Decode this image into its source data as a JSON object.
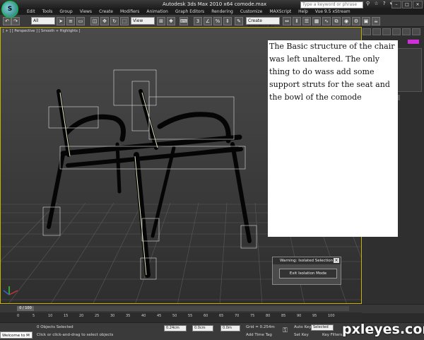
{
  "title": {
    "text": "Autodesk 3ds Max  2010 x64      comode.max",
    "search_placeholder": "Type a keyword or phrase"
  },
  "menu": [
    "Edit",
    "Tools",
    "Group",
    "Views",
    "Create",
    "Modifiers",
    "Animation",
    "Graph Editors",
    "Rendering",
    "Customize",
    "MAXScript",
    "Help",
    "Vue 9.5 xStream"
  ],
  "toolbar": {
    "selection_filter": "All",
    "reference_coord": "View",
    "named_selection": "Create Selection Se"
  },
  "viewport": {
    "label": "[ + ] [ Perspective ] [ Smooth + Highlights ]"
  },
  "note": {
    "text": "The Basic structure of the chair was left unaltered. The only thing to do wass add some support struts for the seat and the bowl of the comode"
  },
  "dialog": {
    "title": "Warning: Isolated Selection",
    "button": "Exit Isolation Mode"
  },
  "timeline": {
    "frame": "0 / 100",
    "ticks": [
      "0",
      "5",
      "10",
      "15",
      "20",
      "25",
      "30",
      "35",
      "40",
      "45",
      "50",
      "55",
      "60",
      "65",
      "70",
      "75",
      "80",
      "85",
      "90",
      "95",
      "100"
    ]
  },
  "status": {
    "welcome": "Welcome to M",
    "objects_selected": "0 Objects Selected",
    "prompt": "Click or click-and-drag to select objects",
    "x_value": "0.24cm",
    "y_value": "0.0cm",
    "z_value": "0.0m",
    "grid": "Grid = 0.254m",
    "auto_key": "Auto Key",
    "selected": "Selected",
    "set_key": "Set Key",
    "key_filters": "Key Filters...",
    "add_time_tag": "Add Time Tag"
  },
  "watermark": "pxleyes.com",
  "colors": {
    "viewport_border": "#c8b400",
    "chair": "#050505"
  }
}
